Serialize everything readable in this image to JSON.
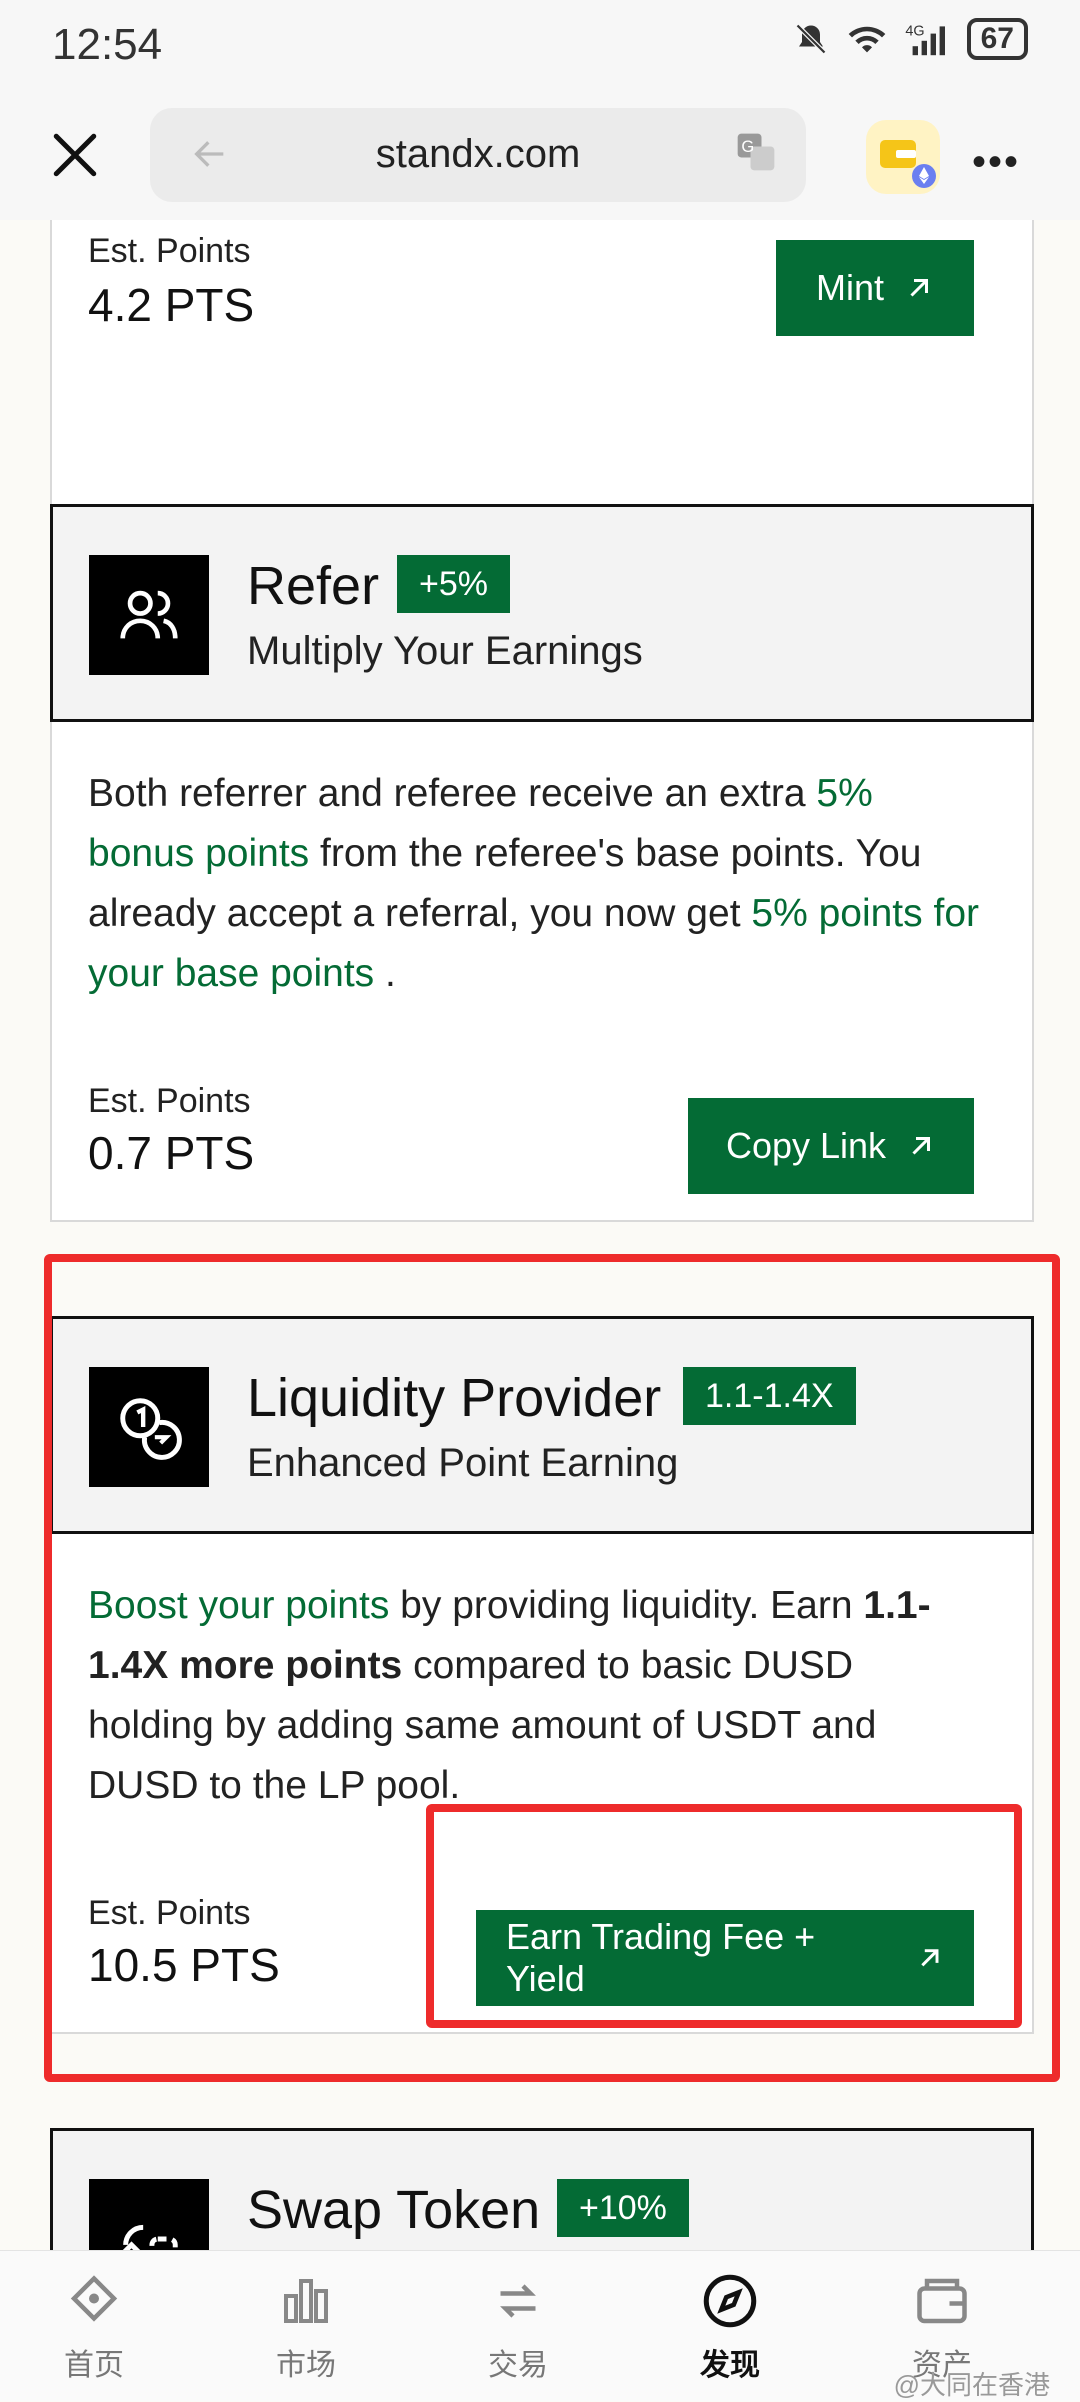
{
  "status_bar": {
    "time": "12:54",
    "battery": "67"
  },
  "browser": {
    "url": "standx.com"
  },
  "cards": [
    {
      "est_label": "Est. Points",
      "est_value": "4.2 PTS",
      "button_label": "Mint"
    },
    {
      "title": "Refer",
      "badge": "+5%",
      "subtitle": "Multiply Your Earnings",
      "desc_parts": [
        "Both referrer and referee receive an extra ",
        "5% bonus points",
        " from the referee's base points. You already accept a referral, you now get ",
        "5% points for your base points",
        " ."
      ],
      "est_label": "Est. Points",
      "est_value": "0.7 PTS",
      "button_label": "Copy Link"
    },
    {
      "title": "Liquidity Provider",
      "badge": "1.1-1.4X",
      "subtitle": "Enhanced Point Earning",
      "desc_parts": [
        "Boost your points",
        " by providing liquidity. Earn ",
        "1.1-1.4X more points",
        " compared to basic DUSD holding by adding same amount of USDT and DUSD to the LP pool."
      ],
      "est_label": "Est. Points",
      "est_value": "10.5 PTS",
      "button_label": "Earn Trading Fee + Yield"
    },
    {
      "title": "Swap Token",
      "badge": "+10%"
    }
  ],
  "bottom_nav": [
    {
      "label": "首页",
      "icon": "home-icon"
    },
    {
      "label": "市场",
      "icon": "market-icon"
    },
    {
      "label": "交易",
      "icon": "trade-icon"
    },
    {
      "label": "发现",
      "icon": "discover-icon",
      "active": true
    },
    {
      "label": "资产",
      "icon": "assets-icon"
    }
  ],
  "watermark": "@大同在香港",
  "colors": {
    "brand_green": "#046b35",
    "highlight_red": "#ee2b2b"
  }
}
